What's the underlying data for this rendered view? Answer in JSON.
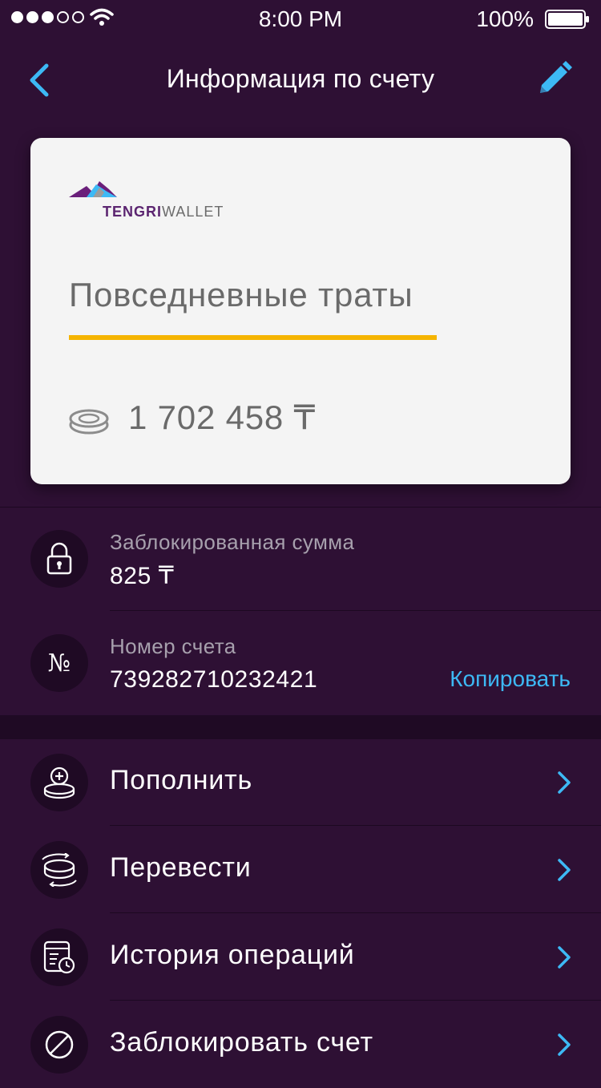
{
  "status_bar": {
    "time": "8:00 PM",
    "battery_percent": "100%",
    "signal_bars_filled": 3,
    "signal_bars_total": 5
  },
  "nav": {
    "title": "Информация по счету",
    "back_icon": "chevron-left-icon",
    "edit_icon": "pencil-icon"
  },
  "card": {
    "logo_brand": "TENGRI",
    "logo_suffix": "WALLET",
    "account_name": "Повседневные траты",
    "balance": "1 702 458 ₸",
    "accent_color": "#f5b400"
  },
  "info": {
    "blocked": {
      "label": "Заблокированная сумма",
      "value": "825 ₸",
      "icon": "lock-icon"
    },
    "account": {
      "label": "Номер счета",
      "value": "739282710232421",
      "icon_text": "№",
      "copy_label": "Копировать"
    }
  },
  "menu": {
    "items": [
      {
        "label": "Пополнить",
        "icon": "coin-plus-icon"
      },
      {
        "label": "Перевести",
        "icon": "coin-transfer-icon"
      },
      {
        "label": "История операций",
        "icon": "history-icon"
      },
      {
        "label": "Заблокировать счет",
        "icon": "block-icon"
      }
    ]
  },
  "colors": {
    "background": "#2e1034",
    "icon_circle": "#1f0a24",
    "accent_blue": "#3db9f5",
    "card_bg": "#f4f4f4"
  }
}
